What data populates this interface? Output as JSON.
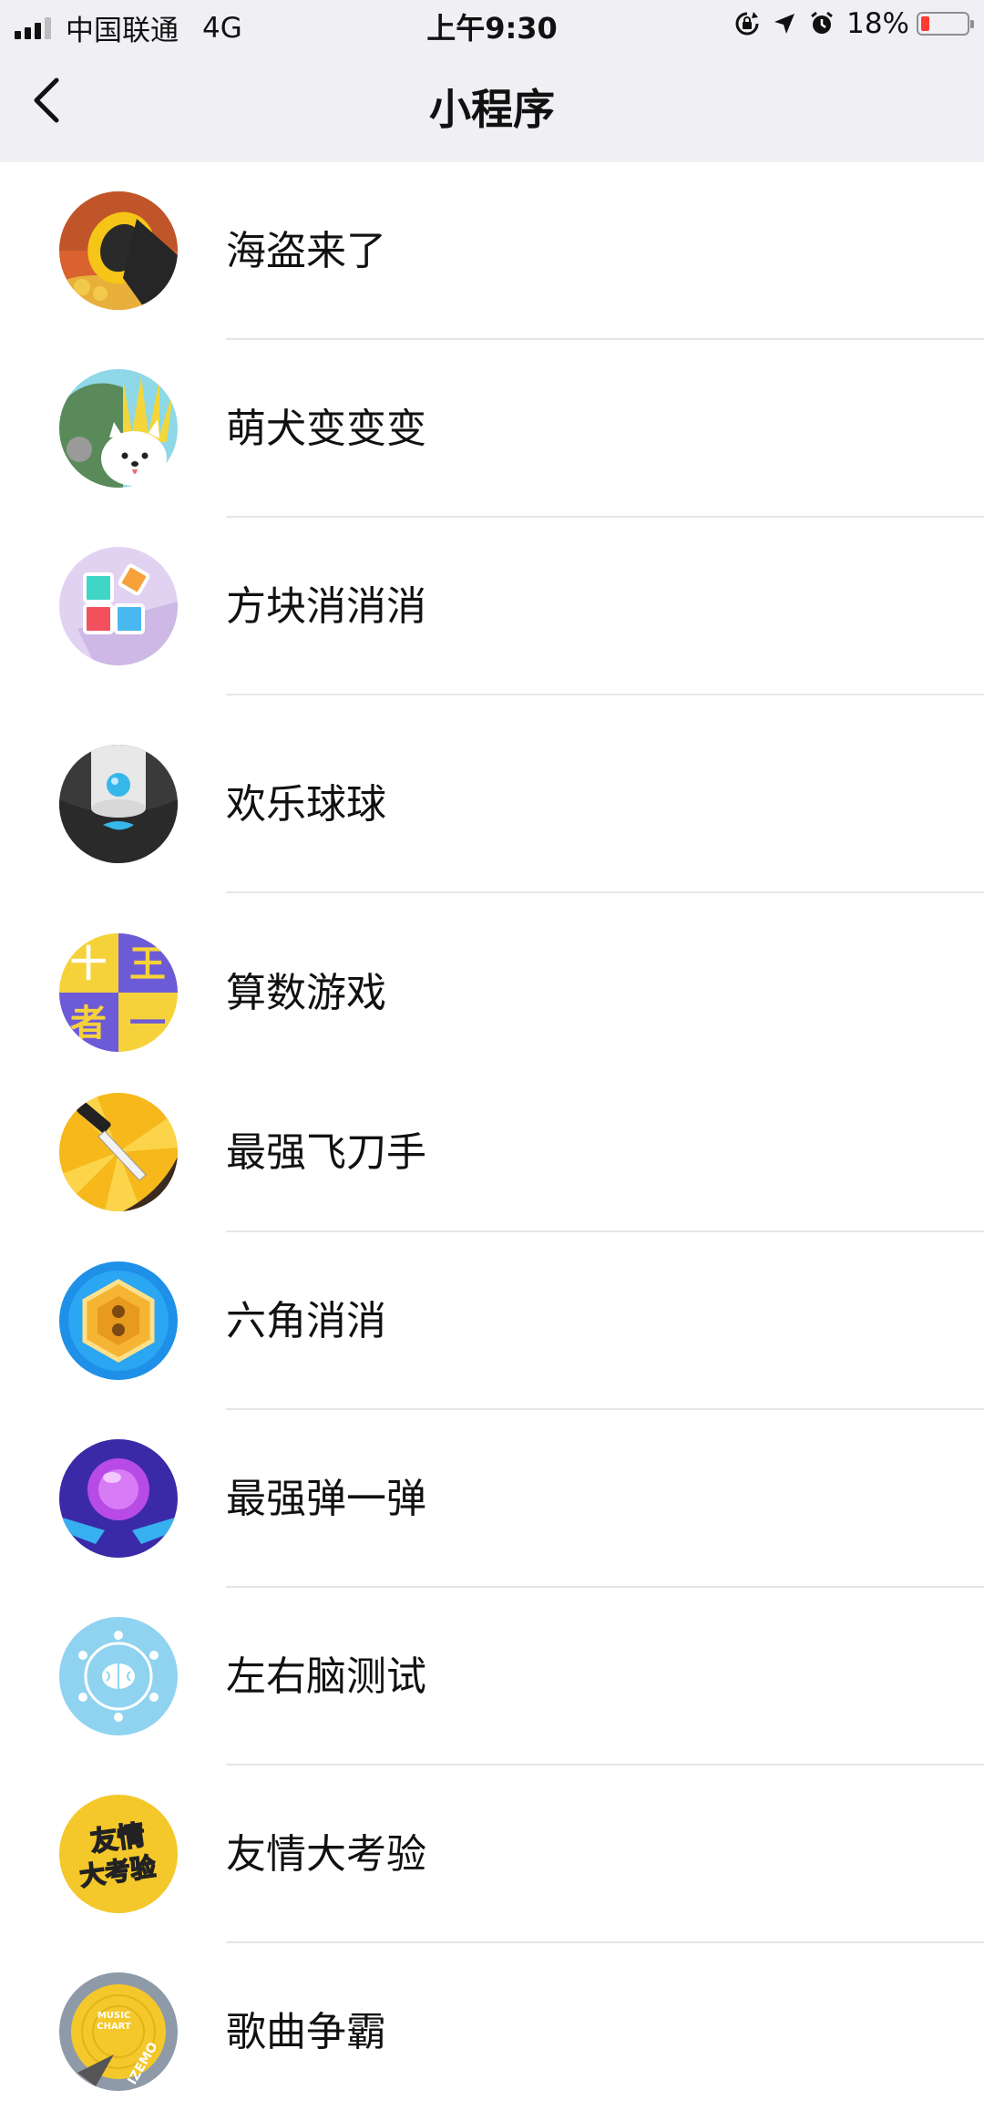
{
  "status_bar": {
    "carrier": "中国联通",
    "network": "4G",
    "time": "上午9:30",
    "battery": "18%",
    "battery_level": 0.18
  },
  "nav": {
    "title": "小程序",
    "back_icon": "chevron-left-icon"
  },
  "items": [
    {
      "label": "海盗来了"
    },
    {
      "label": "萌犬变变变"
    },
    {
      "label": "方块消消消"
    },
    {
      "label": "欢乐球球"
    },
    {
      "label": "算数游戏",
      "icon_text": [
        "十",
        "王",
        "者",
        "一"
      ]
    },
    {
      "label": "最强飞刀手"
    },
    {
      "label": "六角消消"
    },
    {
      "label": "最强弹一弹"
    },
    {
      "label": "左右脑测试"
    },
    {
      "label": "友情大考验",
      "icon_text": [
        "友情",
        "大考验"
      ]
    },
    {
      "label": "歌曲争霸",
      "icon_text": [
        "MUSIC",
        "CHART",
        "IZEMO"
      ]
    }
  ],
  "colors": {
    "nav_background": "#efeff4",
    "divider": "#e6e6e6",
    "battery_low": "#ff3b30"
  }
}
